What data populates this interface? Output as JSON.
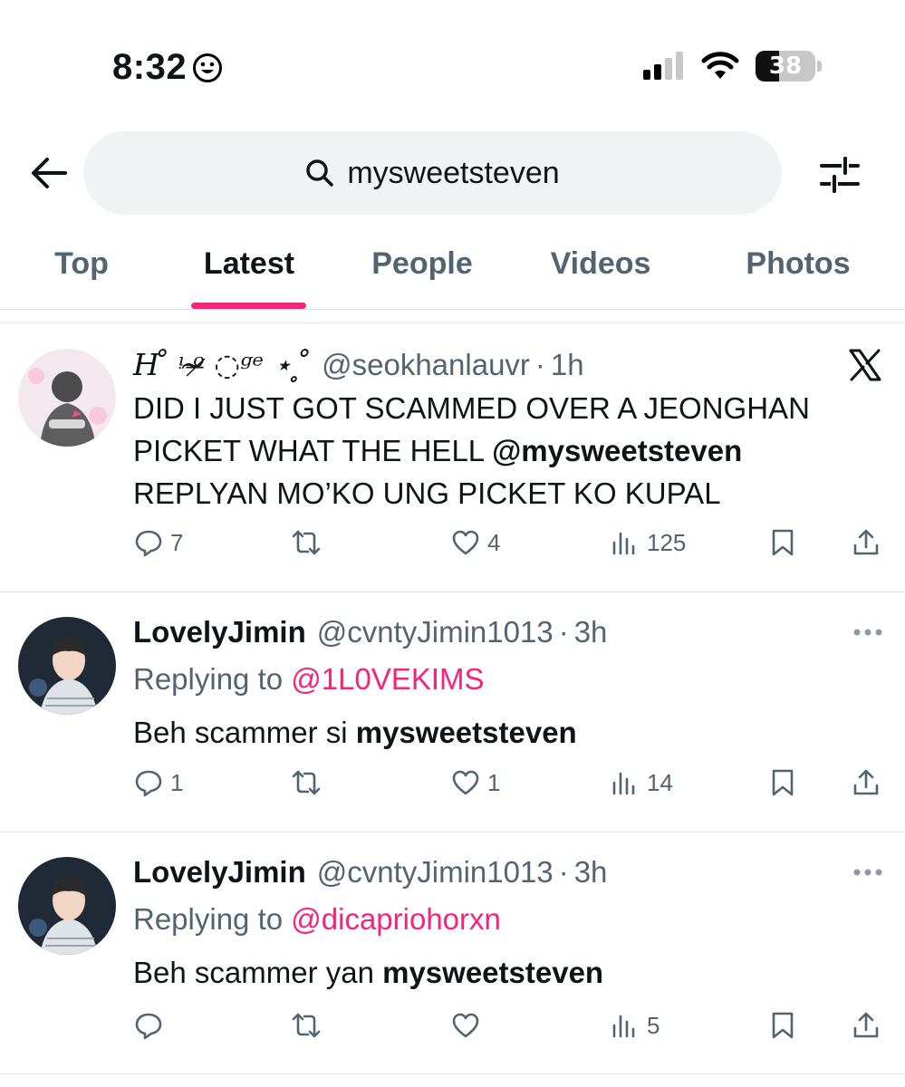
{
  "status": {
    "time": "8:32",
    "battery": "38"
  },
  "search": {
    "query": "mysweetsteven"
  },
  "tabs": [
    "Top",
    "Latest",
    "People",
    "Videos",
    "Photos"
  ],
  "active_tab": "Latest",
  "accent_color": "#f4247c",
  "tweets": [
    {
      "name": "H ̊ ᵎ ᵒ̴̶̷ ◌ᵍᵉ ⋆ ̥ ̊",
      "handle": "@seokhanlauvr",
      "time": "1h",
      "text_1": "DID I JUST GOT SCAMMED OVER A JEONGHAN PICKET WHAT THE HELL ",
      "text_bold": "@mysweetsteven",
      "text_2": " REPLYAN MO’KO UNG PICKET KO KUPAL",
      "replies": "7",
      "retweets": "",
      "likes": "4",
      "views": "125"
    },
    {
      "name": "LovelyJimin",
      "handle": "@cvntyJimin1013",
      "time": "3h",
      "replying_label": "Replying to ",
      "replying_to": "@1L0VEKIMS",
      "text_1": "Beh scammer si ",
      "text_bold": "mysweetsteven",
      "replies": "1",
      "retweets": "",
      "likes": "1",
      "views": "14"
    },
    {
      "name": "LovelyJimin",
      "handle": "@cvntyJimin1013",
      "time": "3h",
      "replying_label": "Replying to ",
      "replying_to": "@dicapriohorxn",
      "text_1": "Beh scammer yan ",
      "text_bold": "mysweetsteven",
      "replies": "",
      "retweets": "",
      "likes": "",
      "views": "5"
    }
  ],
  "icons": [
    "back-arrow-icon",
    "search-icon",
    "filter-icon",
    "x-logo-icon",
    "more-icon",
    "reply-icon",
    "retweet-icon",
    "like-icon",
    "views-icon",
    "bookmark-icon",
    "share-icon"
  ]
}
